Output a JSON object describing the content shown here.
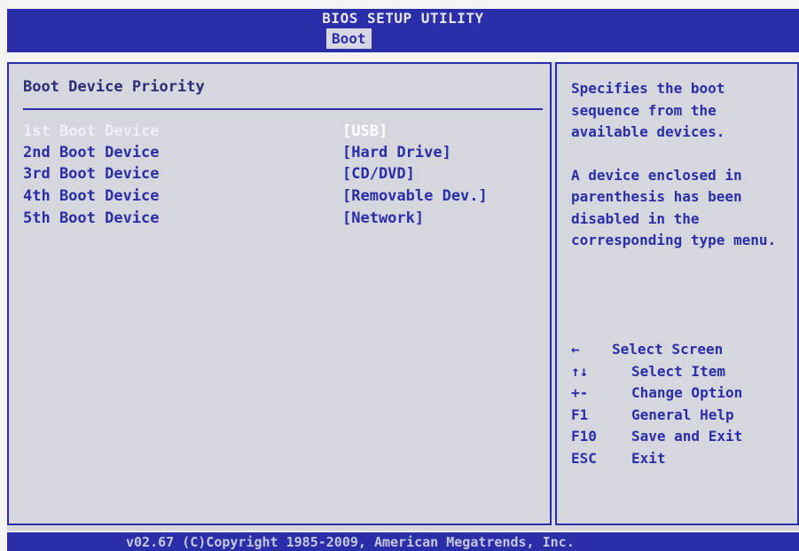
{
  "header": {
    "title": "BIOS SETUP UTILITY",
    "active_tab": "Boot"
  },
  "main": {
    "section_title": "Boot Device Priority",
    "boot_devices": [
      {
        "label": "1st Boot Device",
        "value": "[USB]",
        "selected": true
      },
      {
        "label": "2nd Boot Device",
        "value": "[Hard Drive]",
        "selected": false
      },
      {
        "label": "3rd Boot Device",
        "value": "[CD/DVD]",
        "selected": false
      },
      {
        "label": "4th Boot Device",
        "value": "[Removable Dev.]",
        "selected": false
      },
      {
        "label": "5th Boot Device",
        "value": "[Network]",
        "selected": false
      }
    ]
  },
  "help": {
    "paragraph1": "Specifies the boot sequence from the available devices.",
    "paragraph2": "A device enclosed in parenthesis has been disabled in the corresponding type menu.",
    "keys": [
      {
        "key": "←",
        "action": "Select Screen"
      },
      {
        "key": "↑↓",
        "action": "Select Item"
      },
      {
        "key": "+-",
        "action": "Change Option"
      },
      {
        "key": "F1",
        "action": "General Help"
      },
      {
        "key": "F10",
        "action": "Save and Exit"
      },
      {
        "key": "ESC",
        "action": "Exit"
      }
    ]
  },
  "footer": {
    "text": "v02.67 (C)Copyright 1985-2009, American Megatrends, Inc."
  },
  "colors": {
    "bios_blue": "#2a2ea8",
    "panel_grey": "#d6d6de",
    "highlight_white": "#ffffff"
  }
}
